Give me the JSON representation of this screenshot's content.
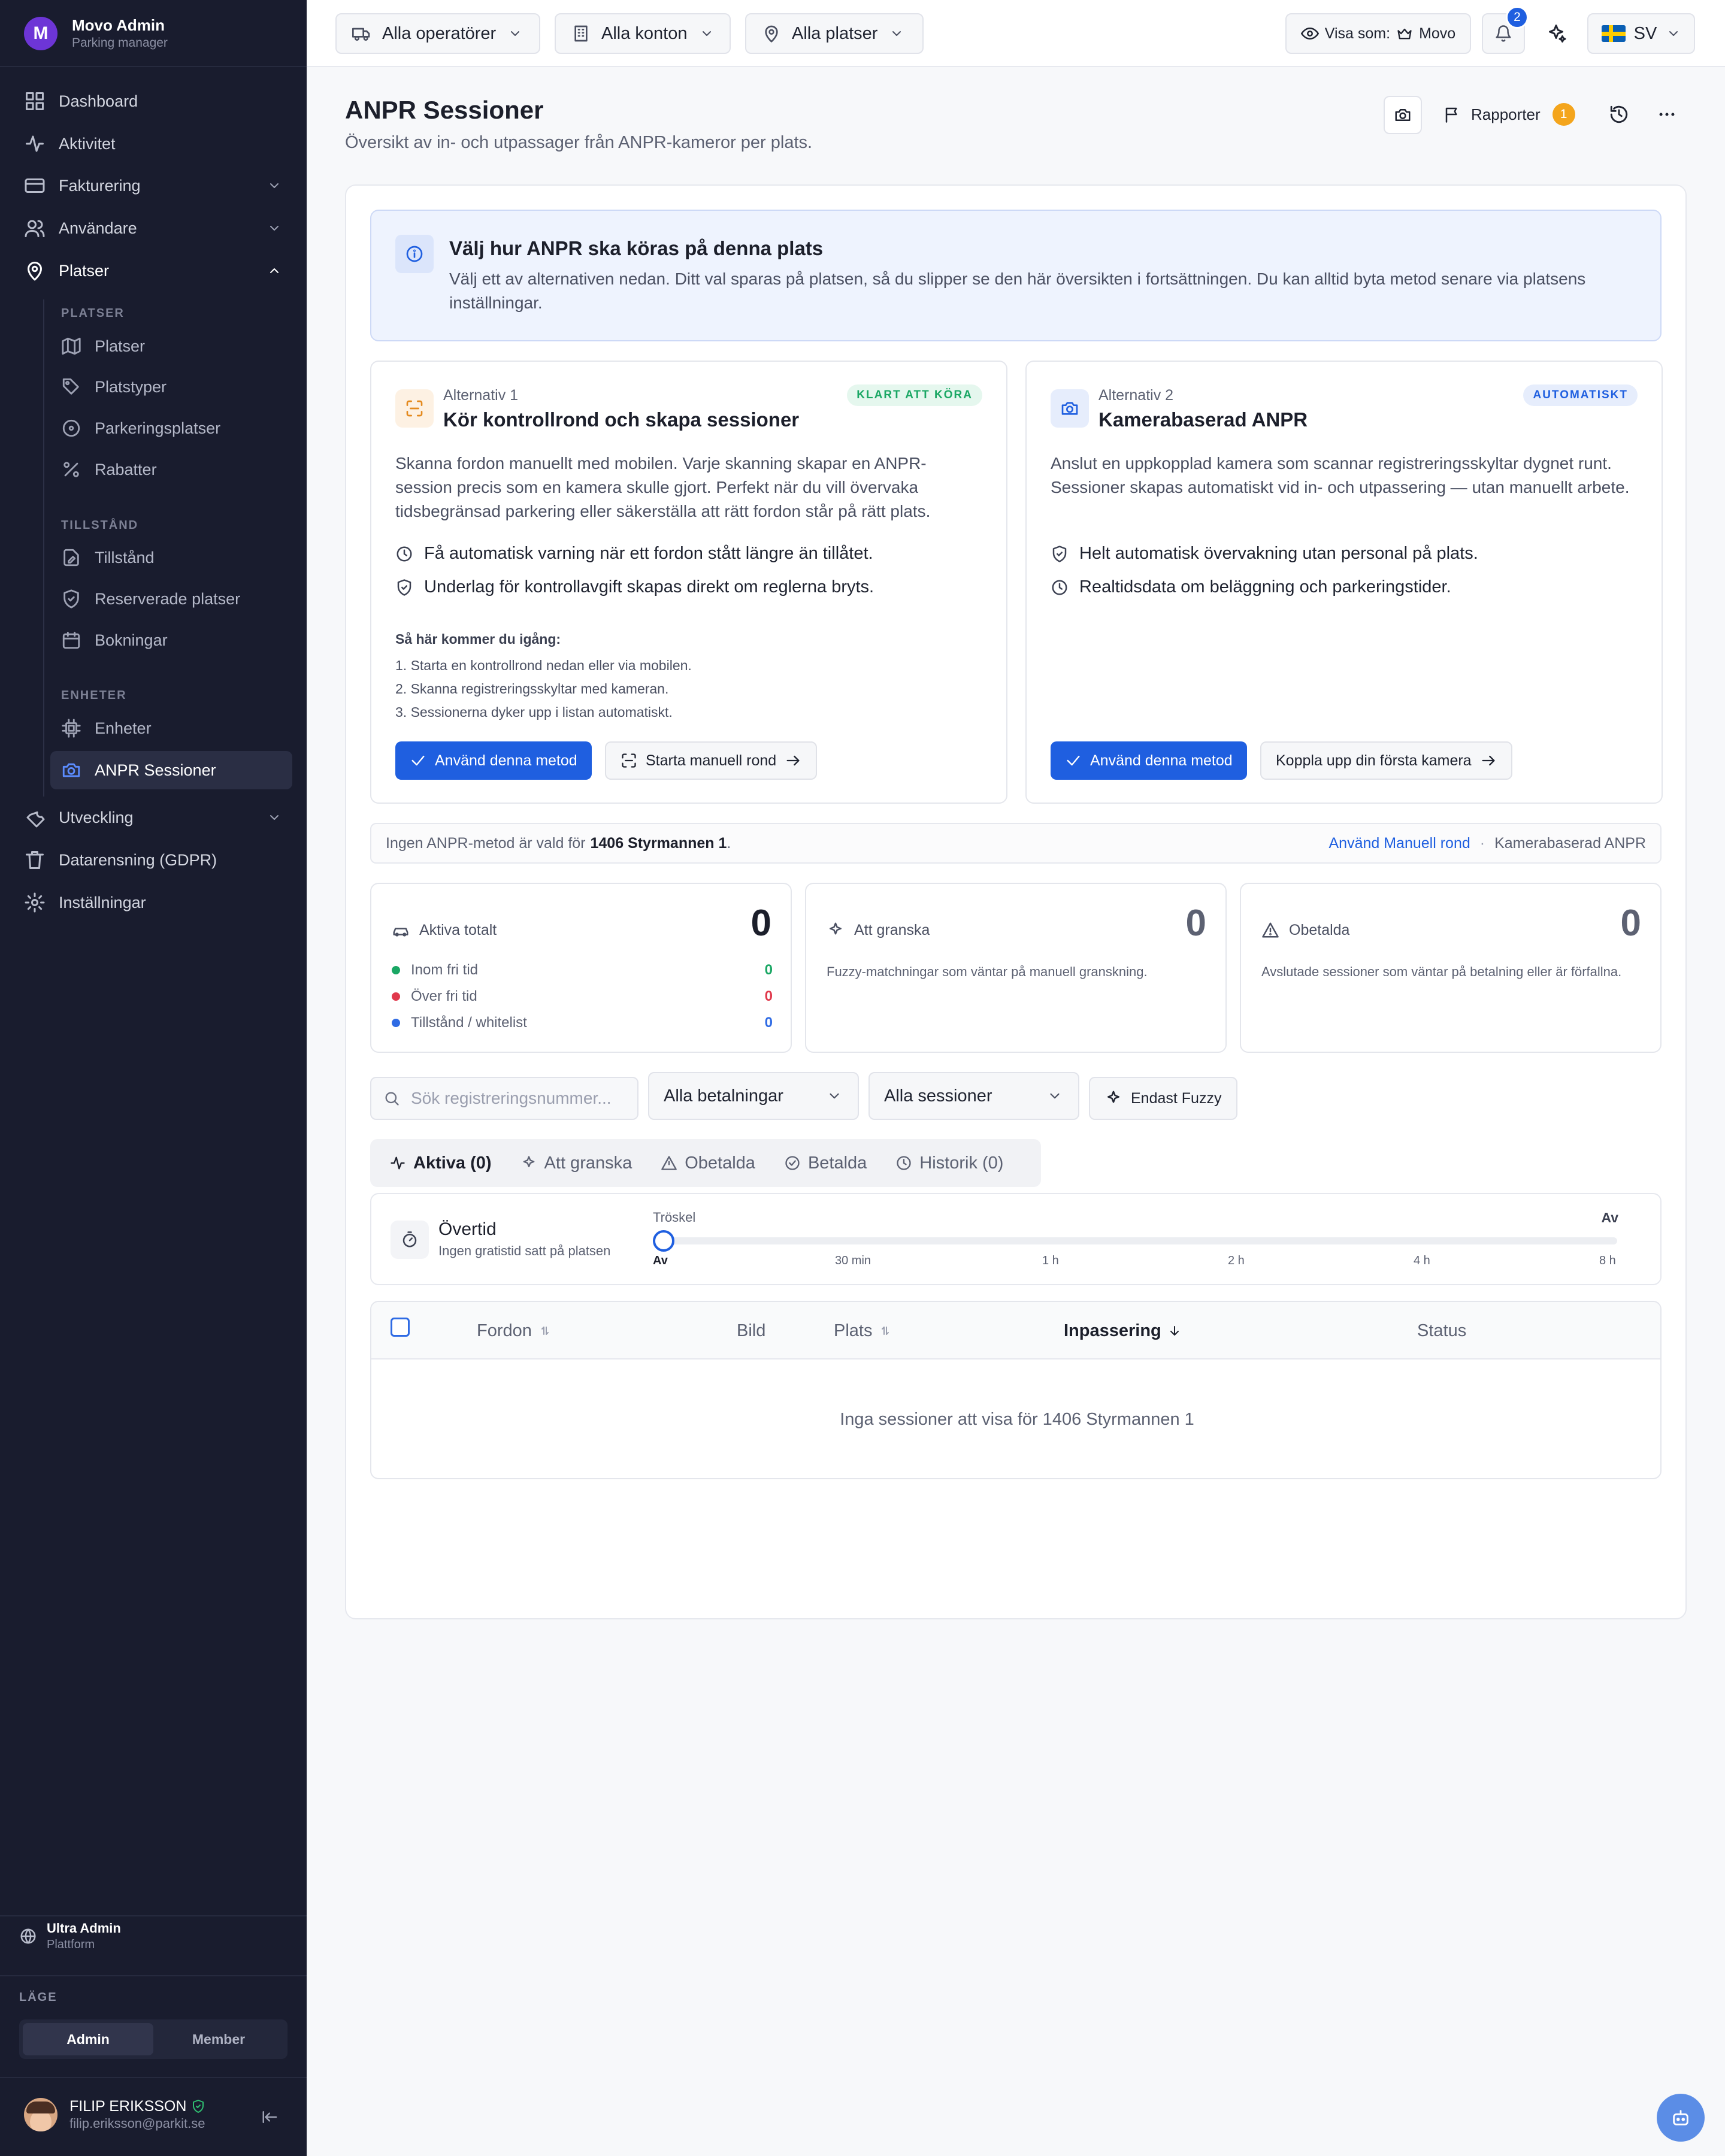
{
  "brand": {
    "title": "Movo Admin",
    "subtitle": "Parking manager",
    "logo": "M"
  },
  "nav": {
    "dashboard": "Dashboard",
    "aktivitet": "Aktivitet",
    "fakturering": "Fakturering",
    "anvandare": "Användare",
    "platser": "Platser",
    "utveckling": "Utveckling",
    "gdpr": "Datarensning (GDPR)",
    "installningar": "Inställningar"
  },
  "sub": {
    "sec_platser": "PLATSER",
    "platser": "Platser",
    "platstyper": "Platstyper",
    "parkeringsplatser": "Parkeringsplatser",
    "rabatter": "Rabatter",
    "sec_tillstand": "TILLSTÅND",
    "tillstand": "Tillstånd",
    "reserverade": "Reserverade platser",
    "bokningar": "Bokningar",
    "sec_enheter": "ENHETER",
    "enheter": "Enheter",
    "anpr": "ANPR Sessioner"
  },
  "account": {
    "name": "Ultra Admin",
    "role": "Plattform"
  },
  "mode": {
    "label": "LÄGE",
    "admin": "Admin",
    "member": "Member"
  },
  "profile": {
    "name": "FILIP ERIKSSON",
    "email": "filip.eriksson@parkit.se"
  },
  "topbar": {
    "operators": "Alla operatörer",
    "accounts": "Alla konton",
    "places": "Alla platser",
    "view_as_label": "Visa som:",
    "view_as_value": "Movo",
    "notif_count": "2",
    "lang": "SV"
  },
  "page": {
    "title": "ANPR Sessioner",
    "subtitle": "Översikt av in- och utpassager från ANPR-kameror per plats.",
    "reports": "Rapporter",
    "reports_count": "1"
  },
  "info": {
    "title": "Välj hur ANPR ska köras på denna plats",
    "text": "Välj ett av alternativen nedan. Ditt val sparas på platsen, så du slipper se den här översikten i fortsättningen. Du kan alltid byta metod senare via platsens inställningar."
  },
  "alt1": {
    "label": "Alternativ 1",
    "title": "Kör kontrollrond och skapa sessioner",
    "pill": "KLART ATT KÖRA",
    "desc": "Skanna fordon manuellt med mobilen. Varje skanning skapar en ANPR-session precis som en kamera skulle gjort. Perfekt när du vill övervaka tidsbegränsad parkering eller säkerställa att rätt fordon står på rätt plats.",
    "feat1": "Få automatisk varning när ett fordon stått längre än tillåtet.",
    "feat2": "Underlag för kontrollavgift skapas direkt om reglerna bryts.",
    "howto": "Så här kommer du igång:",
    "step1": "1. Starta en kontrollrond nedan eller via mobilen.",
    "step2": "2. Skanna registreringsskyltar med kameran.",
    "step3": "3. Sessionerna dyker upp i listan automatiskt.",
    "primary": "Använd denna metod",
    "secondary": "Starta manuell rond"
  },
  "alt2": {
    "label": "Alternativ 2",
    "title": "Kamerabaserad ANPR",
    "pill": "AUTOMATISKT",
    "desc": "Anslut en uppkopplad kamera som scannar registreringsskyltar dygnet runt. Sessioner skapas automatiskt vid in- och utpassering — utan manuellt arbete.",
    "feat1": "Helt automatisk övervakning utan personal på plats.",
    "feat2": "Realtidsdata om beläggning och parkeringstider.",
    "primary": "Använd denna metod",
    "secondary": "Koppla upp din första kamera"
  },
  "strip": {
    "text_before": "Ingen ANPR-metod är vald för ",
    "place": "1406 Styrmannen 1",
    "text_after": ".",
    "link_manual": "Använd Manuell rond",
    "sep": "·",
    "link_camera": "Kamerabaserad ANPR"
  },
  "stats": {
    "active": {
      "label": "Aktiva totalt",
      "value": "0",
      "rows": [
        {
          "label": "Inom fri tid",
          "value": "0"
        },
        {
          "label": "Över fri tid",
          "value": "0"
        },
        {
          "label": "Tillstånd / whitelist",
          "value": "0"
        }
      ]
    },
    "review": {
      "label": "Att granska",
      "value": "0",
      "desc": "Fuzzy-matchningar som väntar på manuell granskning."
    },
    "unpaid": {
      "label": "Obetalda",
      "value": "0",
      "desc": "Avslutade sessioner som väntar på betalning eller är förfallna."
    }
  },
  "filters": {
    "search_placeholder": "Sök registreringsnummer...",
    "payments": "Alla betalningar",
    "sessions": "Alla sessioner",
    "fuzzy": "Endast Fuzzy"
  },
  "tabs": [
    "Aktiva (0)",
    "Att granska",
    "Obetalda",
    "Betalda",
    "Historik (0)"
  ],
  "overtime": {
    "title": "Övertid",
    "subtitle": "Ingen gratistid satt på platsen",
    "threshold_label": "Tröskel",
    "value": "Av",
    "ticks": [
      "Av",
      "30 min",
      "1 h",
      "2 h",
      "4 h",
      "8 h"
    ],
    "slider_position": 0
  },
  "table": {
    "columns": [
      "Fordon",
      "Bild",
      "Plats",
      "Inpassering",
      "Status"
    ],
    "empty": "Inga sessioner att visa för 1406 Styrmannen 1"
  },
  "colors": {
    "sidebar": "#191c2e",
    "accent": "#1f5fe0",
    "green": "#1aa764",
    "red": "#e0384b",
    "blue": "#2f6be4"
  }
}
